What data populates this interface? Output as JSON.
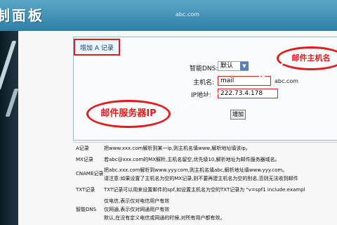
{
  "header": {
    "title": "制面板",
    "domain_text": "abc.com"
  },
  "form": {
    "record_button_label": "增加 A 记录",
    "dns_label": "智能DNS:",
    "dns_selected": "默认",
    "host_label": "主机名:",
    "host_value": "mail",
    "host_suffix": "abc.com",
    "ip_label": "IP地址:",
    "ip_value": "222.73.4.178",
    "add_button_label": "增加"
  },
  "annotations": {
    "mail_host": "邮件主机名",
    "server_ip": "邮件服务器IP"
  },
  "records": [
    {
      "label": "A记录",
      "lines": [
        "把www.xxx.com解析到某一ip,则主机名填www,解析地址填该ip。"
      ]
    },
    {
      "label": "MX记录",
      "lines": [
        "若abc@xxx.com的MX解析,主机名留空,优先级10,解析地址为邮件服务器域名。"
      ]
    },
    {
      "label": "CNAME记录",
      "lines": [
        "把abc.xxx.com解析到www.yyy.com,则主机名填abc,解析地址填www.yyy.com。",
        "请注意:如果设置了主机名为空的MX记录,则不要再建主机名为空的别名,否则无法收到邮件"
      ]
    },
    {
      "label": "TXT记录",
      "lines": [
        "TXT记录可以用来设置邮件的spf,如设置主机名为空的TXT记录为 \"v=spf1 include:exampl"
      ]
    },
    {
      "label": "智能DNS",
      "lines": [
        "仅电信,表示仅对电信用户有效",
        "仅网通,表示仅对网通用户有效",
        "默认,在没有定义电信或网通的时候,对所有用户都有效。"
      ]
    }
  ],
  "colors": {
    "banner": "#2f7fa7",
    "annotation_red": "#e51a1a"
  }
}
